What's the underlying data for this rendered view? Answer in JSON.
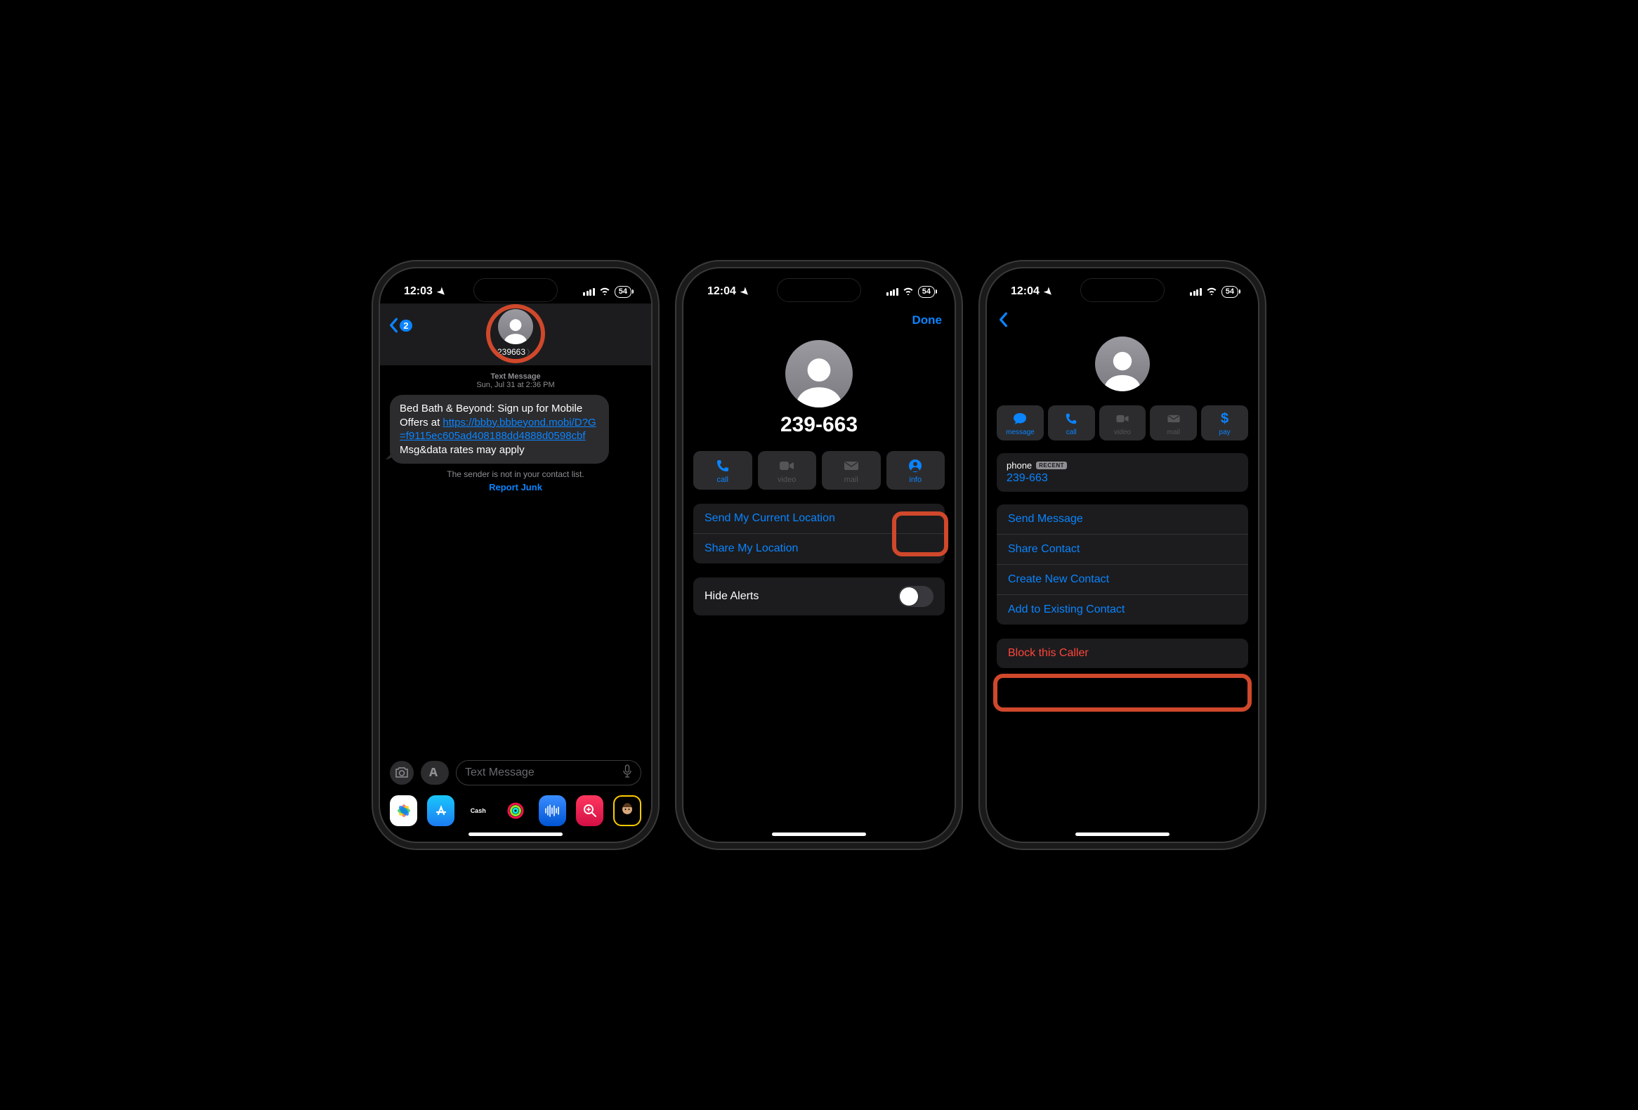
{
  "status": {
    "time1": "12:03",
    "time2": "12:04",
    "time3": "12:04",
    "battery": "54"
  },
  "s1": {
    "back_badge": "2",
    "contact": "239663",
    "meta_type": "Text Message",
    "meta_time": "Sun, Jul 31 at 2:36 PM",
    "msg_prefix": "Bed Bath & Beyond: Sign up for Mobile Offers at ",
    "msg_link": "https://bbby.bbbeyond.mobi/D?G=f9115ec605ad408188dd4888d0598cbf",
    "msg_suffix": " Msg&data rates may apply",
    "sender_note": "The sender is not in your contact list.",
    "report": "Report Junk",
    "compose_placeholder": "Text Message"
  },
  "s2": {
    "done": "Done",
    "title": "239-663",
    "actions": {
      "call": "call",
      "video": "video",
      "mail": "mail",
      "info": "info"
    },
    "send_loc": "Send My Current Location",
    "share_loc": "Share My Location",
    "hide_alerts": "Hide Alerts"
  },
  "s3": {
    "actions": {
      "message": "message",
      "call": "call",
      "video": "video",
      "mail": "mail",
      "pay": "pay"
    },
    "phone_label": "phone",
    "recent": "RECENT",
    "phone_value": "239-663",
    "send_msg": "Send Message",
    "share_contact": "Share Contact",
    "create_contact": "Create New Contact",
    "add_existing": "Add to Existing Contact",
    "block": "Block this Caller"
  }
}
